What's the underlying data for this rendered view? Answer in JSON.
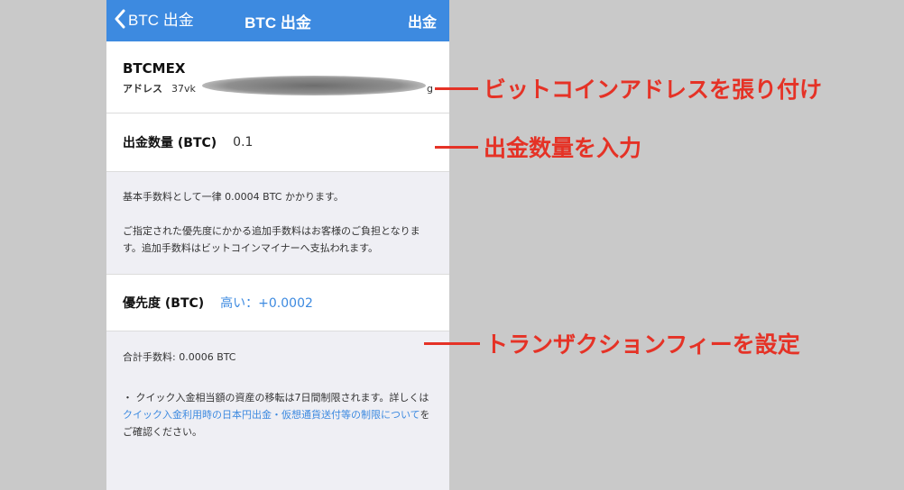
{
  "navbar": {
    "back_label": "BTC 出金",
    "title": "BTC 出金",
    "action_label": "出金"
  },
  "wallet": {
    "name": "BTCMEX",
    "address_label": "アドレス",
    "address_value": "37vk",
    "address_tail": "g"
  },
  "amount": {
    "label": "出金数量 (BTC)",
    "value": "0.1"
  },
  "notes": {
    "fee_basic": "基本手数料として一律 0.0004 BTC かかります。",
    "fee_extra": "ご指定された優先度にかかる追加手数料はお客様のご負担となります。追加手数料はビットコインマイナーへ支払われます。"
  },
  "priority": {
    "label": "優先度 (BTC)",
    "value": "高い：+0.0002"
  },
  "total_fee": "合計手数料: 0.0006 BTC",
  "notice": {
    "prefix": "・ クイック入金相当額の資産の移転は7日間制限されます。詳しくは",
    "link": "クイック入金利用時の日本円出金・仮想通貨送付等の制限について",
    "suffix": "をご確認ください。"
  },
  "annotations": {
    "address": "ビットコインアドレスを張り付け",
    "amount": "出金数量を入力",
    "fee": "トランザクションフィーを設定"
  },
  "colors": {
    "accent": "#3d8ae0",
    "annotation": "#e53226",
    "background": "#c9c9c9"
  }
}
